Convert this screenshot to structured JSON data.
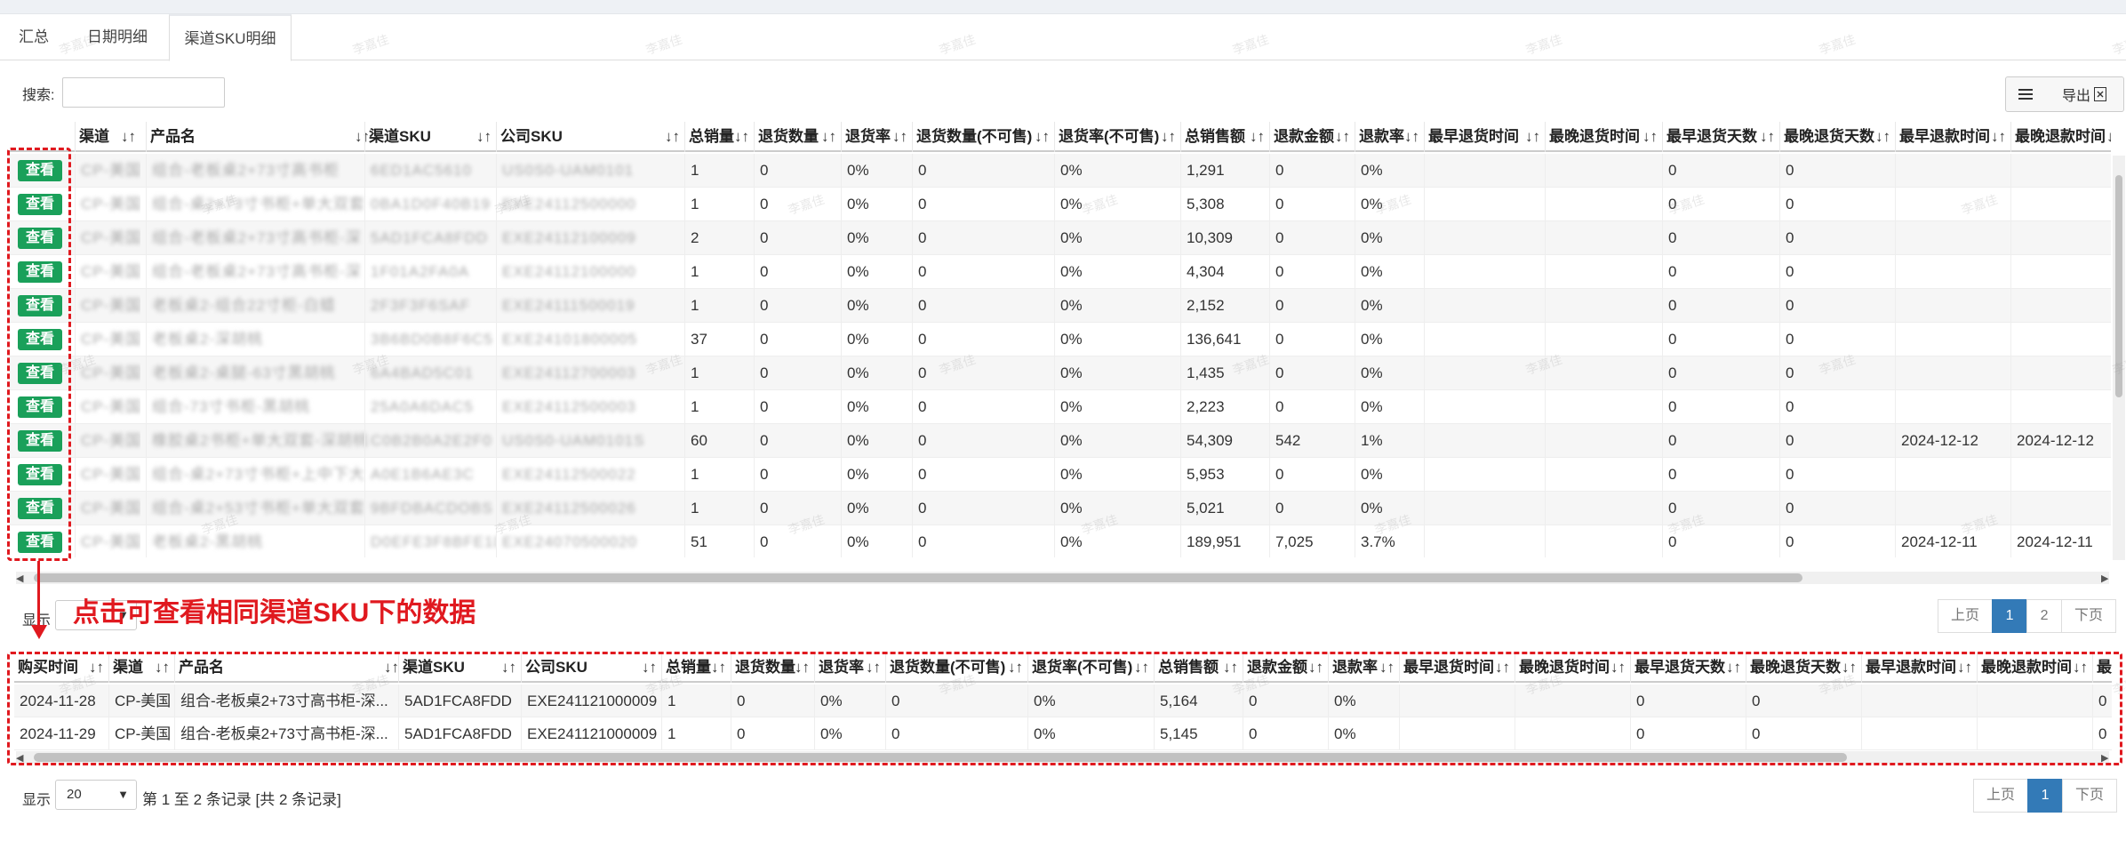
{
  "tabs": [
    {
      "label": "汇总"
    },
    {
      "label": "日期明细"
    },
    {
      "label": "渠道SKU明细"
    }
  ],
  "search": {
    "label": "搜索:",
    "value": "",
    "placeholder": ""
  },
  "toolbar": {
    "export_label": "导出"
  },
  "main_table": {
    "columns": [
      "",
      "渠道",
      "产品名",
      "渠道SKU",
      "公司SKU",
      "总销量",
      "退货数量",
      "退货率",
      "退货数量(不可售)",
      "退货率(不可售)",
      "总销售额",
      "退款金额",
      "退款率",
      "最早退货时间",
      "最晚退货时间",
      "最早退货天数",
      "最晚退货天数",
      "最早退款时间",
      "最晚退款时间"
    ],
    "view_label": "查看",
    "rows": [
      {
        "channel": "CP-美国",
        "product": "组合-老板桌2+73寸高书柜",
        "csku": "6ED1AC5610",
        "ssku": "US0S0-UAM0101",
        "qty": "1",
        "ret": "0",
        "rate": "0%",
        "ret_ns": "0",
        "rate_ns": "0%",
        "sales": "1,291",
        "refund": "0",
        "refund_rate": "0%",
        "e_days": "0",
        "l_days": "0",
        "e_ref": "",
        "l_ref": ""
      },
      {
        "channel": "CP-美国",
        "product": "组合-桌2+73寸书柜+单大双套",
        "csku": "0BA1D0F40B19",
        "ssku": "EXE24112500000",
        "qty": "1",
        "ret": "0",
        "rate": "0%",
        "ret_ns": "0",
        "rate_ns": "0%",
        "sales": "5,308",
        "refund": "0",
        "refund_rate": "0%",
        "e_days": "0",
        "l_days": "0",
        "e_ref": "",
        "l_ref": ""
      },
      {
        "channel": "CP-美国",
        "product": "组合-老板桌2+73寸高书柜-深",
        "csku": "5AD1FCA8FDD",
        "ssku": "EXE24112100009",
        "qty": "2",
        "ret": "0",
        "rate": "0%",
        "ret_ns": "0",
        "rate_ns": "0%",
        "sales": "10,309",
        "refund": "0",
        "refund_rate": "0%",
        "e_days": "0",
        "l_days": "0",
        "e_ref": "",
        "l_ref": ""
      },
      {
        "channel": "CP-美国",
        "product": "组合-老板桌2+73寸高书柜-深",
        "csku": "1F01A2FA0A",
        "ssku": "EXE24112100000",
        "qty": "1",
        "ret": "0",
        "rate": "0%",
        "ret_ns": "0",
        "rate_ns": "0%",
        "sales": "4,304",
        "refund": "0",
        "refund_rate": "0%",
        "e_days": "0",
        "l_days": "0",
        "e_ref": "",
        "l_ref": ""
      },
      {
        "channel": "CP-美国",
        "product": "老板桌2-组合22寸柜-白蜡",
        "csku": "2F3F3F6SAF",
        "ssku": "EXE24111500019",
        "qty": "1",
        "ret": "0",
        "rate": "0%",
        "ret_ns": "0",
        "rate_ns": "0%",
        "sales": "2,152",
        "refund": "0",
        "refund_rate": "0%",
        "e_days": "0",
        "l_days": "0",
        "e_ref": "",
        "l_ref": ""
      },
      {
        "channel": "CP-美国",
        "product": "老板桌2-深胡桃",
        "csku": "3B6BD0B8F6C5",
        "ssku": "EXE24101800005",
        "qty": "37",
        "ret": "0",
        "rate": "0%",
        "ret_ns": "0",
        "rate_ns": "0%",
        "sales": "136,641",
        "refund": "0",
        "refund_rate": "0%",
        "e_days": "0",
        "l_days": "0",
        "e_ref": "",
        "l_ref": ""
      },
      {
        "channel": "CP-美国",
        "product": "老板桌2-桌腿-63寸黑胡桃",
        "csku": "6A4BAD5C01",
        "ssku": "EXE24112700003",
        "qty": "1",
        "ret": "0",
        "rate": "0%",
        "ret_ns": "0",
        "rate_ns": "0%",
        "sales": "1,435",
        "refund": "0",
        "refund_rate": "0%",
        "e_days": "0",
        "l_days": "0",
        "e_ref": "",
        "l_ref": ""
      },
      {
        "channel": "CP-美国",
        "product": "组合-73寸书柜-黑胡桃",
        "csku": "25A0A6DAC5",
        "ssku": "EXE24112500003",
        "qty": "1",
        "ret": "0",
        "rate": "0%",
        "ret_ns": "0",
        "rate_ns": "0%",
        "sales": "2,223",
        "refund": "0",
        "refund_rate": "0%",
        "e_days": "0",
        "l_days": "0",
        "e_ref": "",
        "l_ref": ""
      },
      {
        "channel": "CP-美国",
        "product": "橡胶桌2书柜+单大双套-深胡桃",
        "csku": "C0B2B0A2E2F0",
        "ssku": "US0S0-UAM0101S",
        "qty": "60",
        "ret": "0",
        "rate": "0%",
        "ret_ns": "0",
        "rate_ns": "0%",
        "sales": "54,309",
        "refund": "542",
        "refund_rate": "1%",
        "e_days": "0",
        "l_days": "0",
        "e_ref": "2024-12-12",
        "l_ref": "2024-12-12"
      },
      {
        "channel": "CP-美国",
        "product": "组合-桌2+73寸书柜+上中下大",
        "csku": "A0E1B6AE3C",
        "ssku": "EXE24112500022",
        "qty": "1",
        "ret": "0",
        "rate": "0%",
        "ret_ns": "0",
        "rate_ns": "0%",
        "sales": "5,953",
        "refund": "0",
        "refund_rate": "0%",
        "e_days": "0",
        "l_days": "0",
        "e_ref": "",
        "l_ref": ""
      },
      {
        "channel": "CP-美国",
        "product": "组合-桌2+53寸书柜+单大双套",
        "csku": "9BFDBACDOBS",
        "ssku": "EXE24112500026",
        "qty": "1",
        "ret": "0",
        "rate": "0%",
        "ret_ns": "0",
        "rate_ns": "0%",
        "sales": "5,021",
        "refund": "0",
        "refund_rate": "0%",
        "e_days": "0",
        "l_days": "0",
        "e_ref": "",
        "l_ref": ""
      },
      {
        "channel": "CP-美国",
        "product": "老板桌2-黑胡桃",
        "csku": "D0EFE3F8BFE1D",
        "ssku": "EXE24070500020",
        "qty": "51",
        "ret": "0",
        "rate": "0%",
        "ret_ns": "0",
        "rate_ns": "0%",
        "sales": "189,951",
        "refund": "7,025",
        "refund_rate": "3.7%",
        "e_days": "0",
        "l_days": "0",
        "e_ref": "2024-12-11",
        "l_ref": "2024-12-11"
      }
    ]
  },
  "main_pager": {
    "prev": "上页",
    "pages": [
      "1",
      "2"
    ],
    "next": "下页",
    "show_label": "显示"
  },
  "annotation": {
    "text": "点击可查看相同渠道SKU下的数据"
  },
  "detail_table": {
    "columns": [
      "购买时间",
      "渠道",
      "产品名",
      "渠道SKU",
      "公司SKU",
      "总销量",
      "退货数量",
      "退货率",
      "退货数量(不可售)",
      "退货率(不可售)",
      "总销售额",
      "退款金额",
      "退款率",
      "最早退货时间",
      "最晚退货时间",
      "最早退货天数",
      "最晚退货天数",
      "最早退款时间",
      "最晚退款时间",
      "最"
    ],
    "rows": [
      {
        "date": "2024-11-28",
        "channel": "CP-美国",
        "product": "组合-老板桌2+73寸高书柜-深...",
        "csku": "5AD1FCA8FDD",
        "ssku": "EXE241121000009",
        "qty": "1",
        "ret": "0",
        "rate": "0%",
        "ret_ns": "0",
        "rate_ns": "0%",
        "sales": "5,164",
        "refund": "0",
        "refund_rate": "0%",
        "e_days": "0",
        "l_days": "0",
        "last": "0"
      },
      {
        "date": "2024-11-29",
        "channel": "CP-美国",
        "product": "组合-老板桌2+73寸高书柜-深...",
        "csku": "5AD1FCA8FDD",
        "ssku": "EXE241121000009",
        "qty": "1",
        "ret": "0",
        "rate": "0%",
        "ret_ns": "0",
        "rate_ns": "0%",
        "sales": "5,145",
        "refund": "0",
        "refund_rate": "0%",
        "e_days": "0",
        "l_days": "0",
        "last": "0"
      }
    ]
  },
  "detail_footer": {
    "show_label": "显示",
    "page_length": "20",
    "info": "第 1 至 2 条记录 [共 2 条记录]",
    "prev": "上页",
    "page": "1",
    "next": "下页"
  },
  "watermark": "李嘉佳"
}
